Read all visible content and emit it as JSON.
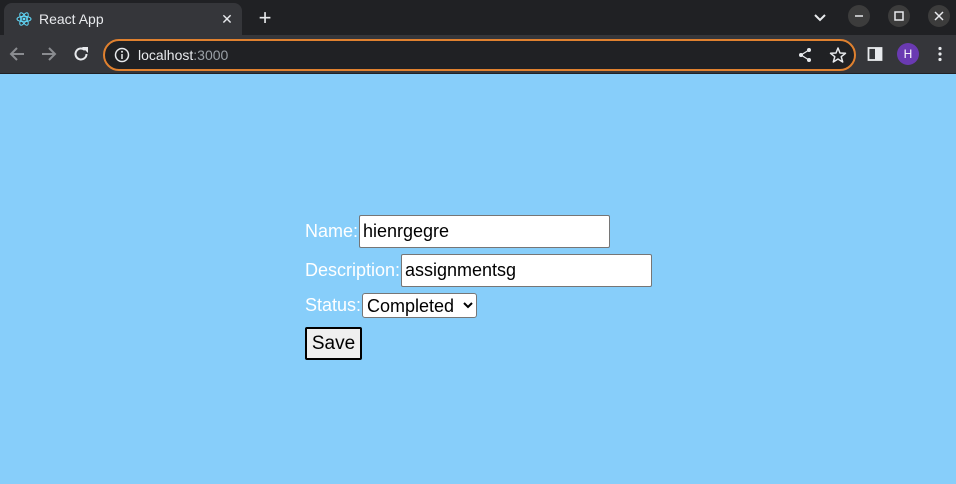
{
  "browser": {
    "tab_title": "React App",
    "url_host": "localhost",
    "url_port": ":3000",
    "profile_initial": "H",
    "accent_color": "#e0812f",
    "profile_color": "#6a3ab2"
  },
  "page": {
    "background": "#87cefa"
  },
  "form": {
    "name_label": "Name:",
    "name_value": "hienrgegre",
    "description_label": "Description:",
    "description_value": "assignmentsg",
    "status_label": "Status:",
    "status_value": "Completed",
    "save_label": "Save"
  }
}
